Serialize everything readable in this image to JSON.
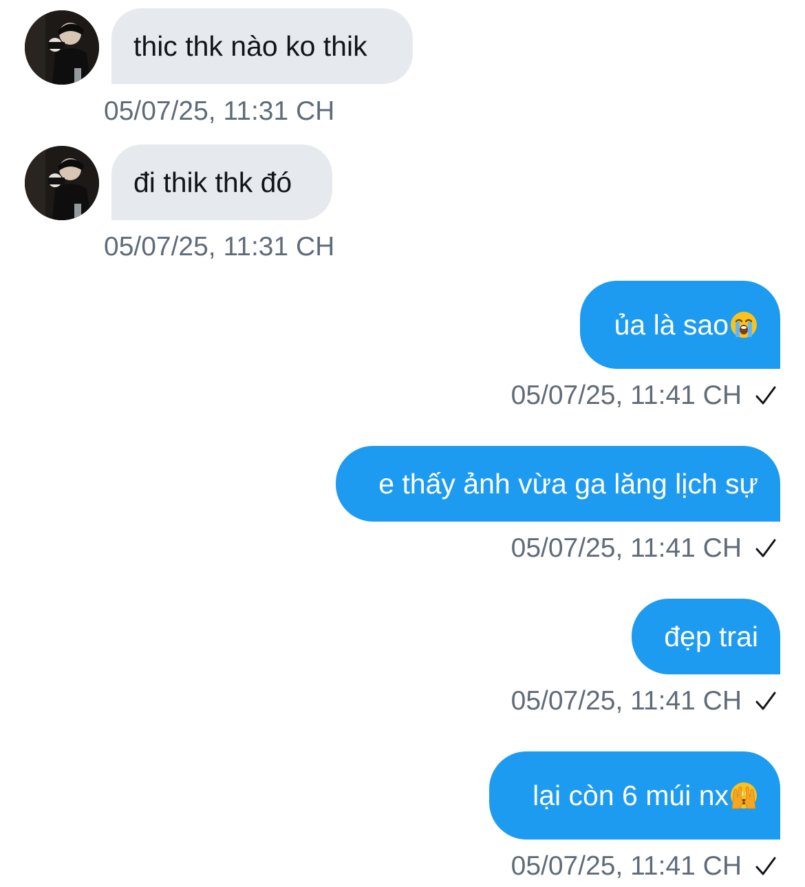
{
  "colors": {
    "incoming_bubble": "#e6e9ee",
    "outgoing_bubble": "#1d9bf0",
    "timestamp": "#5f6b78"
  },
  "messages": [
    {
      "direction": "incoming",
      "text": "thic thk nào ko thik",
      "timestamp": "05/07/25, 11:31 CH"
    },
    {
      "direction": "incoming",
      "text": "đi thik thk đó",
      "timestamp": "05/07/25, 11:31 CH"
    },
    {
      "direction": "outgoing",
      "text": "ủa là sao",
      "emoji": "loudly-crying-face-icon",
      "timestamp": "05/07/25, 11:41 CH",
      "status_icon": "checkmark-icon"
    },
    {
      "direction": "outgoing",
      "text": "e thấy ảnh vừa ga lăng lịch sự",
      "timestamp": "05/07/25, 11:41 CH",
      "status_icon": "checkmark-icon"
    },
    {
      "direction": "outgoing",
      "text": "đẹp trai",
      "timestamp": "05/07/25, 11:41 CH",
      "status_icon": "checkmark-icon"
    },
    {
      "direction": "outgoing",
      "text": "lại còn 6 múi nx",
      "emoji": "face-with-peeking-eye-icon",
      "timestamp": "05/07/25, 11:41 CH",
      "status_icon": "checkmark-icon"
    }
  ]
}
